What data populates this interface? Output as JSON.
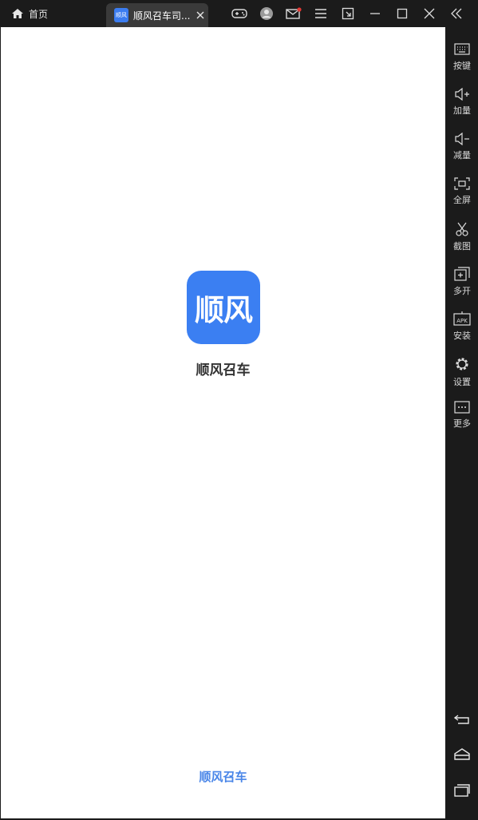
{
  "titlebar": {
    "home_label": "首页",
    "home_icon": "home-icon",
    "tab_title": "顺风召车司...",
    "tab_icon_text": "顺风",
    "tab_close_icon": "close-icon",
    "icons": [
      "gamepad-icon",
      "user-icon",
      "mail-icon",
      "menu-icon",
      "popout-icon",
      "minimize-icon",
      "maximize-icon",
      "close-window-icon",
      "collapse-sidebar-icon"
    ],
    "mail_badge_color": "#e53935"
  },
  "app": {
    "logo_text": "顺风",
    "name": "顺风召车",
    "footer": "顺风召车",
    "brand_color": "#3b7ff2"
  },
  "sidebar": {
    "items": [
      {
        "label": "按键",
        "icon": "keyboard-icon"
      },
      {
        "label": "加量",
        "icon": "volume-up-icon"
      },
      {
        "label": "减量",
        "icon": "volume-down-icon"
      },
      {
        "label": "全屏",
        "icon": "fullscreen-icon"
      },
      {
        "label": "截图",
        "icon": "scissors-icon"
      },
      {
        "label": "多开",
        "icon": "multi-instance-icon"
      },
      {
        "label": "安装",
        "icon": "apk-icon"
      },
      {
        "label": "设置",
        "icon": "gear-icon"
      },
      {
        "label": "更多",
        "icon": "more-icon"
      }
    ],
    "nav": [
      "back-icon",
      "home-nav-icon",
      "recent-apps-icon"
    ]
  }
}
